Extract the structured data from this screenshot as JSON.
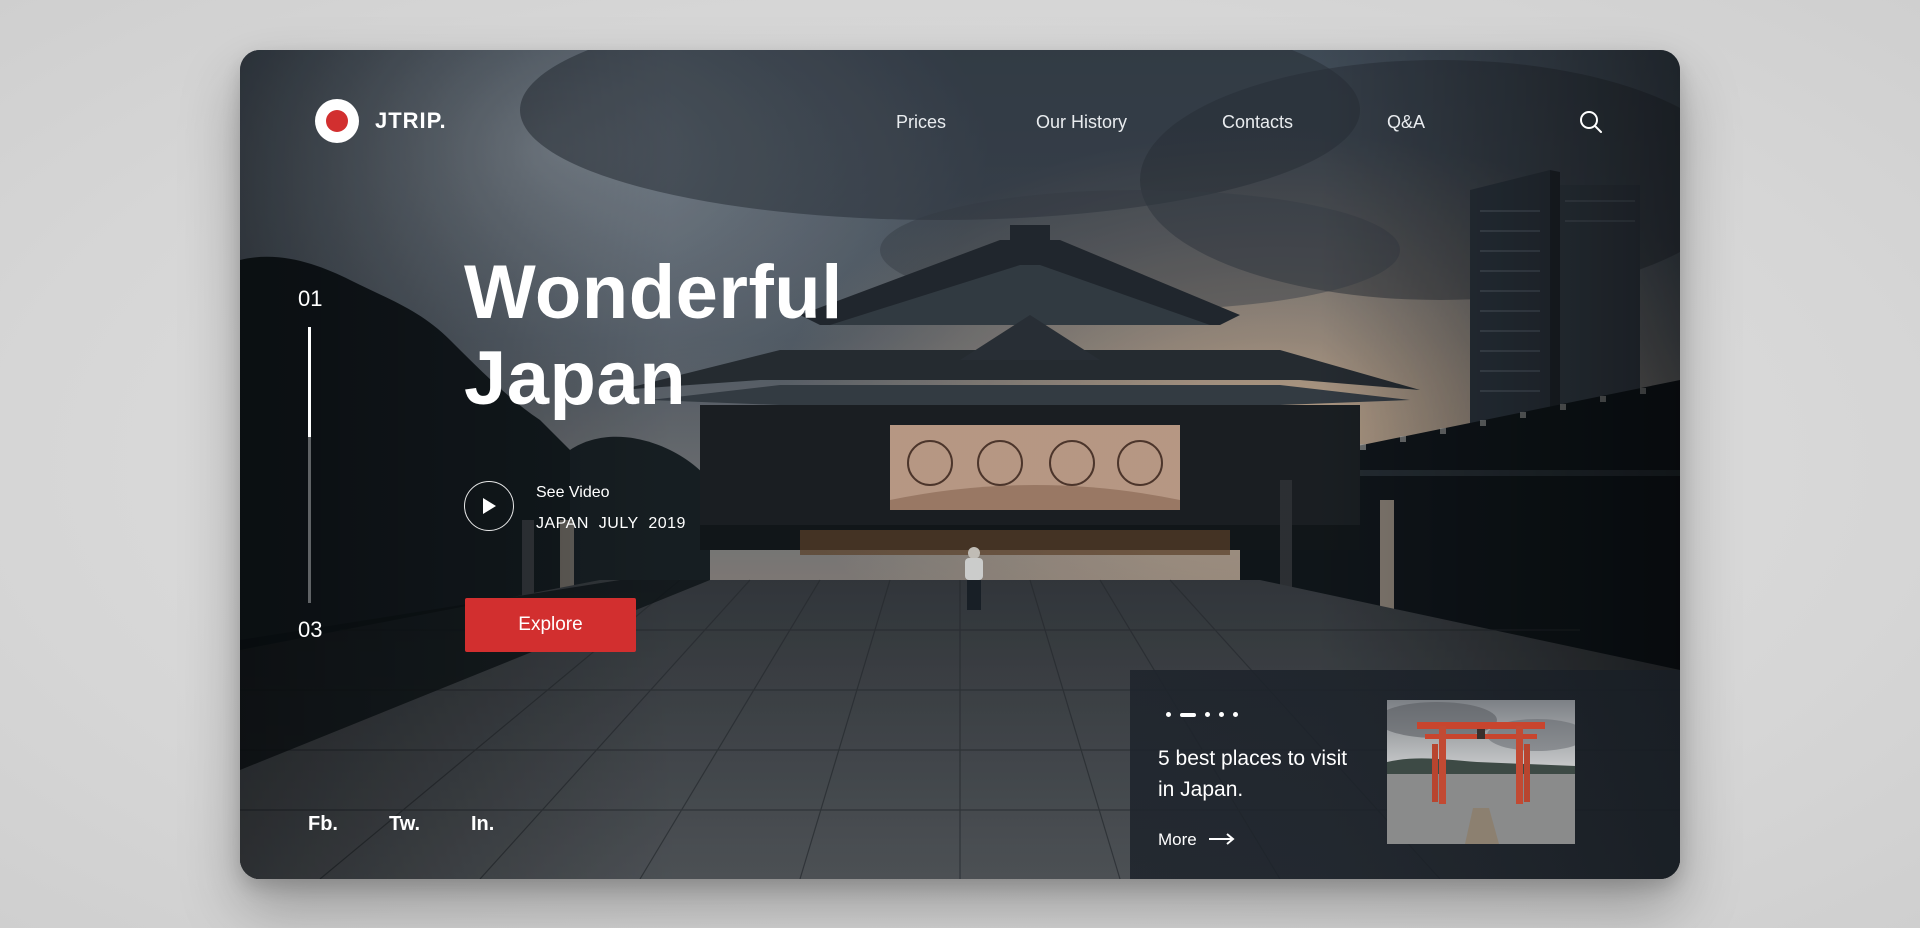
{
  "brand": {
    "name": "JTRIP.",
    "accent_color": "#d22f2f"
  },
  "nav": {
    "items": [
      {
        "label": "Prices"
      },
      {
        "label": "Our History"
      },
      {
        "label": "Contacts"
      },
      {
        "label": "Q&A"
      }
    ],
    "search_icon": "search-icon"
  },
  "slider": {
    "current": "01",
    "total": "03",
    "progress": 0.4
  },
  "hero": {
    "title_line1": "Wonderful",
    "title_line2": "Japan",
    "video_label": "See Video",
    "video_caption": "JAPAN  JULY  2019",
    "explore_label": "Explore"
  },
  "social": {
    "items": [
      {
        "label": "Fb."
      },
      {
        "label": "Tw."
      },
      {
        "label": "In."
      }
    ]
  },
  "featured": {
    "dots_count": 5,
    "active_dot": 1,
    "title": "5 best places to visit in Japan.",
    "more_label": "More"
  }
}
